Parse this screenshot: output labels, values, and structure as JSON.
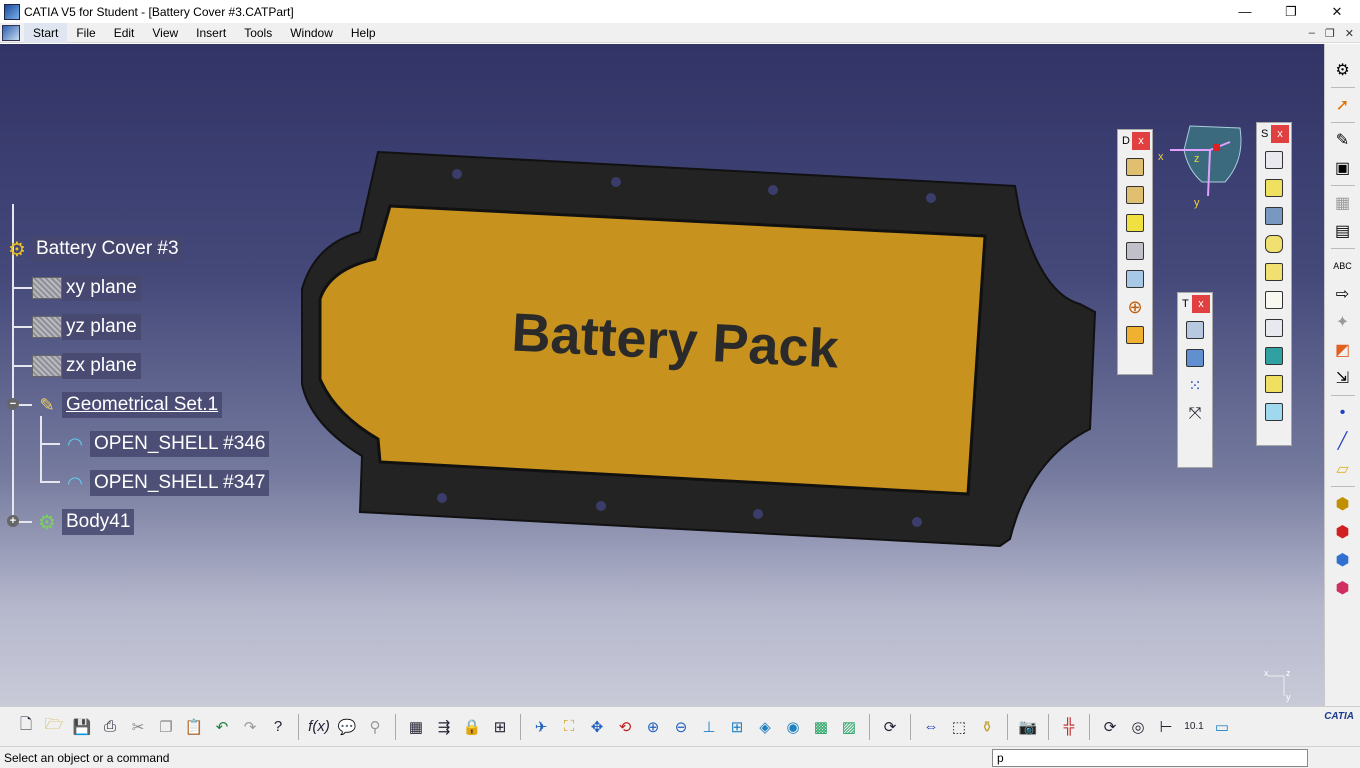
{
  "window": {
    "title": "CATIA V5 for Student - [Battery Cover #3.CATPart]",
    "minimize": "—",
    "maximize": "❐",
    "close": "✕"
  },
  "menu": {
    "items": [
      "Start",
      "File",
      "Edit",
      "View",
      "Insert",
      "Tools",
      "Window",
      "Help"
    ]
  },
  "tree": {
    "root": "Battery Cover #3",
    "planes": [
      "xy plane",
      "yz plane",
      "zx plane"
    ],
    "geoset": "Geometrical Set.1",
    "shells": [
      "OPEN_SHELL #346",
      "OPEN_SHELL #347"
    ],
    "body": "Body41"
  },
  "model": {
    "label": "Battery Pack",
    "panel_color": "#c8921f",
    "frame_color": "#232323"
  },
  "compass": {
    "x": "x",
    "y": "y",
    "z": "z"
  },
  "axis_corner": {
    "x": "x",
    "z": "z",
    "y": "y"
  },
  "toolbars": {
    "d_title": "D",
    "t_title": "T",
    "s_title": "S",
    "close": "x"
  },
  "status": {
    "prompt": "Select an object or a command",
    "command_value": "p"
  },
  "branding": {
    "logo": "CATIA"
  },
  "colors": {
    "viewport_top": "#323366",
    "viewport_bottom": "#c9cad8",
    "accent": "#c8921f"
  }
}
